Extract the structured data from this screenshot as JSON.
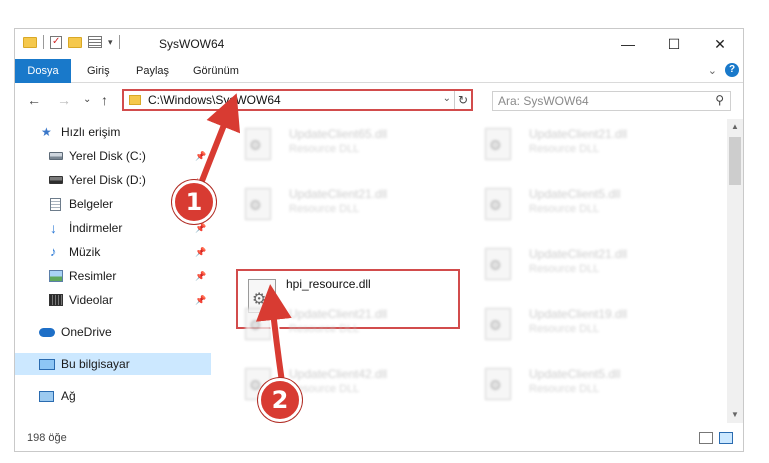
{
  "window": {
    "title": "SysWOW64",
    "controls": {
      "minimize": "—",
      "maximize": "☐",
      "close": "✕"
    }
  },
  "ribbon": {
    "tabs": [
      {
        "label": "Dosya"
      },
      {
        "label": "Giriş"
      },
      {
        "label": "Paylaş"
      },
      {
        "label": "Görünüm"
      }
    ],
    "help": "?",
    "expand": "⌄"
  },
  "nav": {
    "back": "←",
    "forward": "→",
    "recent": "⌄",
    "up": "↑",
    "address": "C:\\Windows\\SysWOW64",
    "refresh": "↻",
    "address_dropdown": "⌄",
    "search_placeholder": "Ara: SysWOW64",
    "search_icon": "⚲"
  },
  "sidebar": {
    "items": [
      {
        "label": "Hızlı erişim",
        "icon": "star-icon",
        "pinned": false
      },
      {
        "label": "Yerel Disk (C:)",
        "icon": "disk-icon",
        "pinned": true
      },
      {
        "label": "Yerel Disk (D:)",
        "icon": "disk-icon",
        "pinned": true
      },
      {
        "label": "Belgeler",
        "icon": "documents-icon",
        "pinned": true
      },
      {
        "label": "İndirmeler",
        "icon": "downloads-icon",
        "pinned": true
      },
      {
        "label": "Müzik",
        "icon": "music-icon",
        "pinned": true
      },
      {
        "label": "Resimler",
        "icon": "pictures-icon",
        "pinned": true
      },
      {
        "label": "Videolar",
        "icon": "videos-icon",
        "pinned": true
      },
      {
        "label": "OneDrive",
        "icon": "cloud-icon",
        "pinned": false
      },
      {
        "label": "Bu bilgisayar",
        "icon": "pc-icon",
        "pinned": false,
        "selected": true
      },
      {
        "label": "Ağ",
        "icon": "network-icon",
        "pinned": false
      }
    ],
    "pin_glyph": "📌"
  },
  "files": {
    "left_column": [
      {
        "name": "UpdateClient65.dll",
        "type": "Resource DLL"
      },
      {
        "name": "UpdateClient21.dll",
        "type": "Resource DLL"
      },
      {
        "name": "hpi_resource.dll",
        "type": ""
      },
      {
        "name": "UpdateClient21.dll",
        "type": "Resource DLL"
      },
      {
        "name": "UpdateClient42.dll",
        "type": "Resource DLL"
      }
    ],
    "right_column": [
      {
        "name": "UpdateClient21.dll",
        "type": "Resource DLL"
      },
      {
        "name": "UpdateClient5.dll",
        "type": "Resource DLL"
      },
      {
        "name": "UpdateClient21.dll",
        "type": "Resource DLL"
      },
      {
        "name": "UpdateClient19.dll",
        "type": "Resource DLL"
      },
      {
        "name": "UpdateClient5.dll",
        "type": "Resource DLL"
      }
    ],
    "highlighted_name": "hpi_resource.dll"
  },
  "status": {
    "item_count": "198 öğe"
  },
  "callouts": {
    "one": "1",
    "two": "2"
  },
  "colors": {
    "accent": "#1979ca",
    "highlight": "#d24c4c",
    "callout": "#d83b32",
    "selected": "#cce8ff"
  }
}
